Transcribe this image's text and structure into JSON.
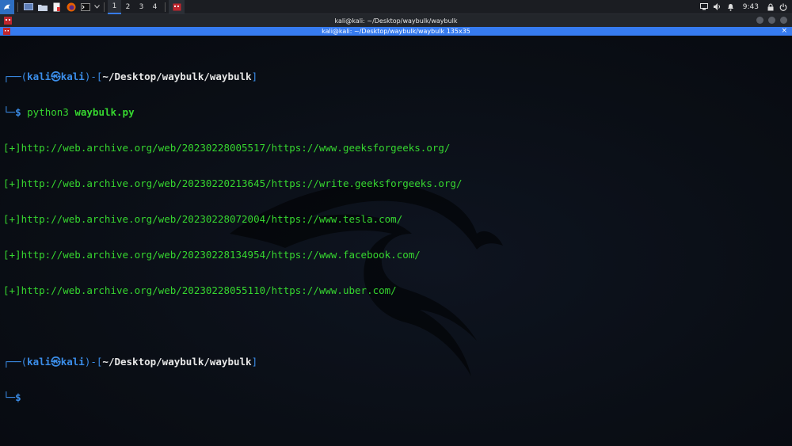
{
  "panel": {
    "workspaces": [
      "1",
      "2",
      "3",
      "4"
    ],
    "active_workspace": 0,
    "clock": "9:43",
    "launcher_icon": "kali-dragon-icon",
    "app_icons": [
      "files-icon",
      "file-manager-icon",
      "text-editor-icon",
      "firefox-icon",
      "terminal-icon"
    ],
    "tray_icons": [
      "display-icon",
      "speaker-icon",
      "bell-icon",
      "lock-icon",
      "power-icon"
    ]
  },
  "window": {
    "title": "kali@kali: ~/Desktop/waybulk/waybulk",
    "tab_title": "kali@kali: ~/Desktop/waybulk/waybulk 135x35"
  },
  "colors": {
    "accent": "#367bf0",
    "prompt_blue": "#3b8eea",
    "output_green": "#36d62f"
  },
  "terminal": {
    "prompt1": {
      "corner_top": "┌──(",
      "user": "kali",
      "at": "㉿",
      "host": "kali",
      "mid": ")-[",
      "path": "~/Desktop/waybulk/waybulk",
      "end": "]",
      "corner_bottom": "└─",
      "dollar": "$",
      "cmd": "python3",
      "arg": "waybulk.py"
    },
    "output": [
      "[+]http://web.archive.org/web/20230228005517/https://www.geeksforgeeks.org/",
      "[+]http://web.archive.org/web/20230220213645/https://write.geeksforgeeks.org/",
      "[+]http://web.archive.org/web/20230228072004/https://www.tesla.com/",
      "[+]http://web.archive.org/web/20230228134954/https://www.facebook.com/",
      "[+]http://web.archive.org/web/20230228055110/https://www.uber.com/"
    ],
    "prompt2": {
      "corner_top": "┌──(",
      "user": "kali",
      "at": "㉿",
      "host": "kali",
      "mid": ")-[",
      "path": "~/Desktop/waybulk/waybulk",
      "end": "]",
      "corner_bottom": "└─",
      "dollar": "$"
    }
  }
}
